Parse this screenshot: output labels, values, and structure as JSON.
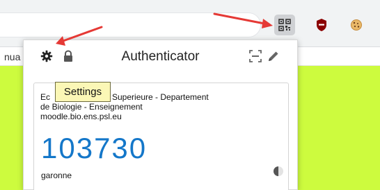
{
  "browser": {
    "nav_fragment": "nua",
    "extensions": [
      {
        "name": "authenticator",
        "icon": "qr-code-icon"
      },
      {
        "name": "ublock",
        "icon": "shield-icon",
        "color": "#800000"
      },
      {
        "name": "cookie",
        "icon": "cookie-icon"
      }
    ]
  },
  "popup": {
    "title": "Authenticator",
    "header_icons": [
      "gear-icon",
      "lock-icon",
      "scan-qr-icon",
      "pencil-icon"
    ],
    "tooltip": "Settings",
    "account": {
      "issuer_lines": [
        "Ec",
        "Superieure - Departement",
        "de Biologie - Enseignement",
        "moodle.bio.ens.psl.eu"
      ],
      "code": "103730",
      "name": "garonne",
      "code_color": "#1477c9"
    }
  },
  "colors": {
    "page_background": "#cdfb3e",
    "annotation_arrow": "#e53935",
    "tooltip_background": "#fbf7b6"
  }
}
